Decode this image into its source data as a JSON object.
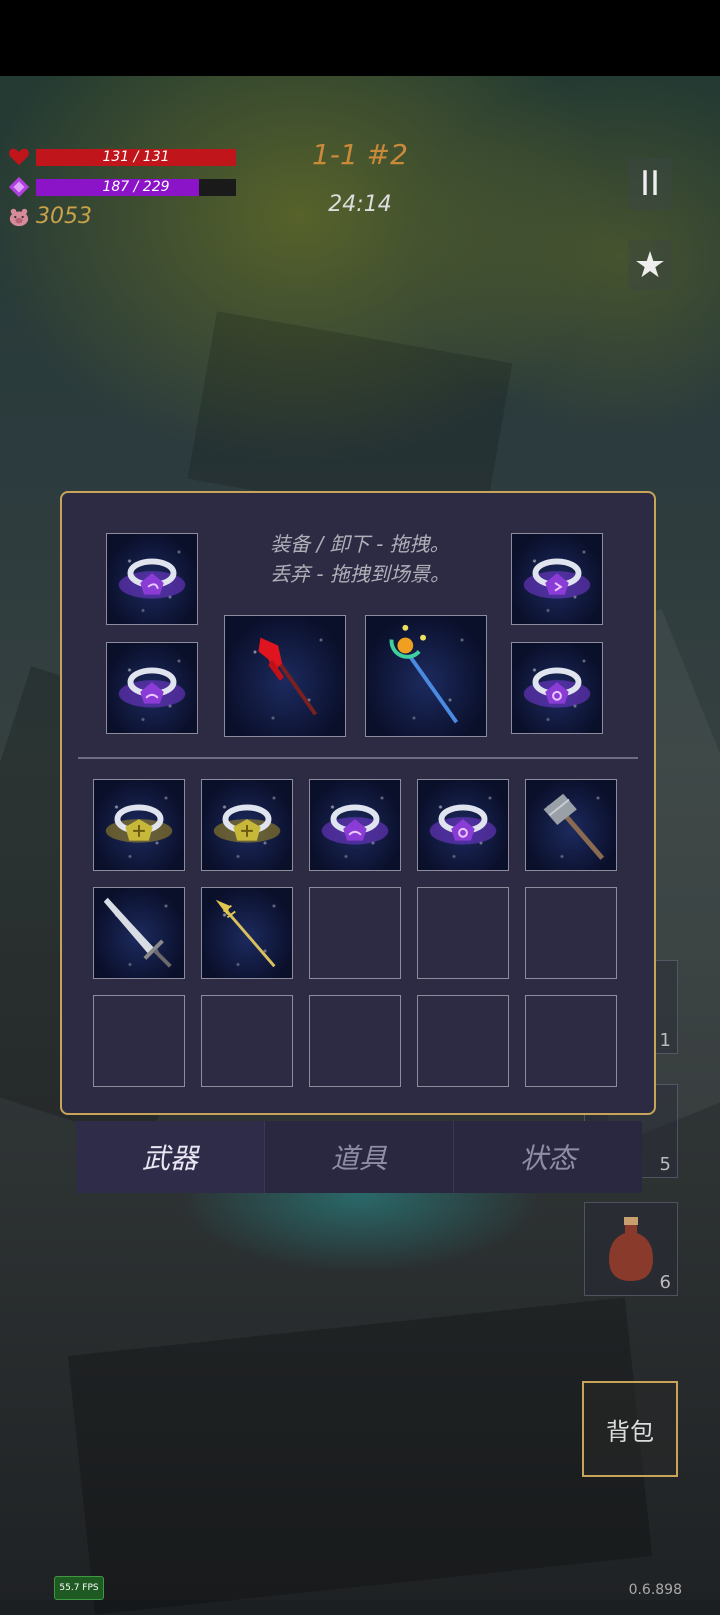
{
  "hud": {
    "hp_text": "131 / 131",
    "hp_fraction": 1.0,
    "mana_text": "187 / 229",
    "mana_fraction": 0.8166,
    "gold": "3053",
    "stage": "1-1 #2",
    "timer": "24:14",
    "pause_icon": "II",
    "star_icon": "★"
  },
  "colors": {
    "hp": "#c0151a",
    "mana": "#8c14c8",
    "gold": "#c9a24a",
    "panel_border": "#c8a458"
  },
  "inventory": {
    "instructions_line1": "装备 / 卸下 - 拖拽。",
    "instructions_line2": "丢弃 - 拖拽到场景。",
    "equipped": [
      {
        "slot": "ring-top-left",
        "icon": "ring-purple-crescent-icon"
      },
      {
        "slot": "ring-bottom-left",
        "icon": "ring-purple-swirl-icon"
      },
      {
        "slot": "weapon-main",
        "icon": "red-spear-icon"
      },
      {
        "slot": "weapon-off",
        "icon": "celestial-staff-icon"
      },
      {
        "slot": "ring-top-right",
        "icon": "ring-purple-rune-icon"
      },
      {
        "slot": "ring-bottom-right",
        "icon": "ring-purple-spiral-icon"
      }
    ],
    "backpack": [
      "ring-gold-cross-icon",
      "ring-gold-cross-icon",
      "ring-purple-swirl-icon",
      "ring-purple-spiral-icon",
      "hammer-icon",
      "sword-icon",
      "golden-spear-icon",
      "",
      "",
      "",
      "",
      "",
      "",
      "",
      ""
    ]
  },
  "tabs": [
    {
      "label": "武器",
      "active": true
    },
    {
      "label": "道具",
      "active": false
    },
    {
      "label": "状态",
      "active": false
    }
  ],
  "quickbar": [
    "1",
    "5",
    "6"
  ],
  "backpack_button": "背包",
  "fps": "55.7 FPS",
  "version": "0.6.898"
}
